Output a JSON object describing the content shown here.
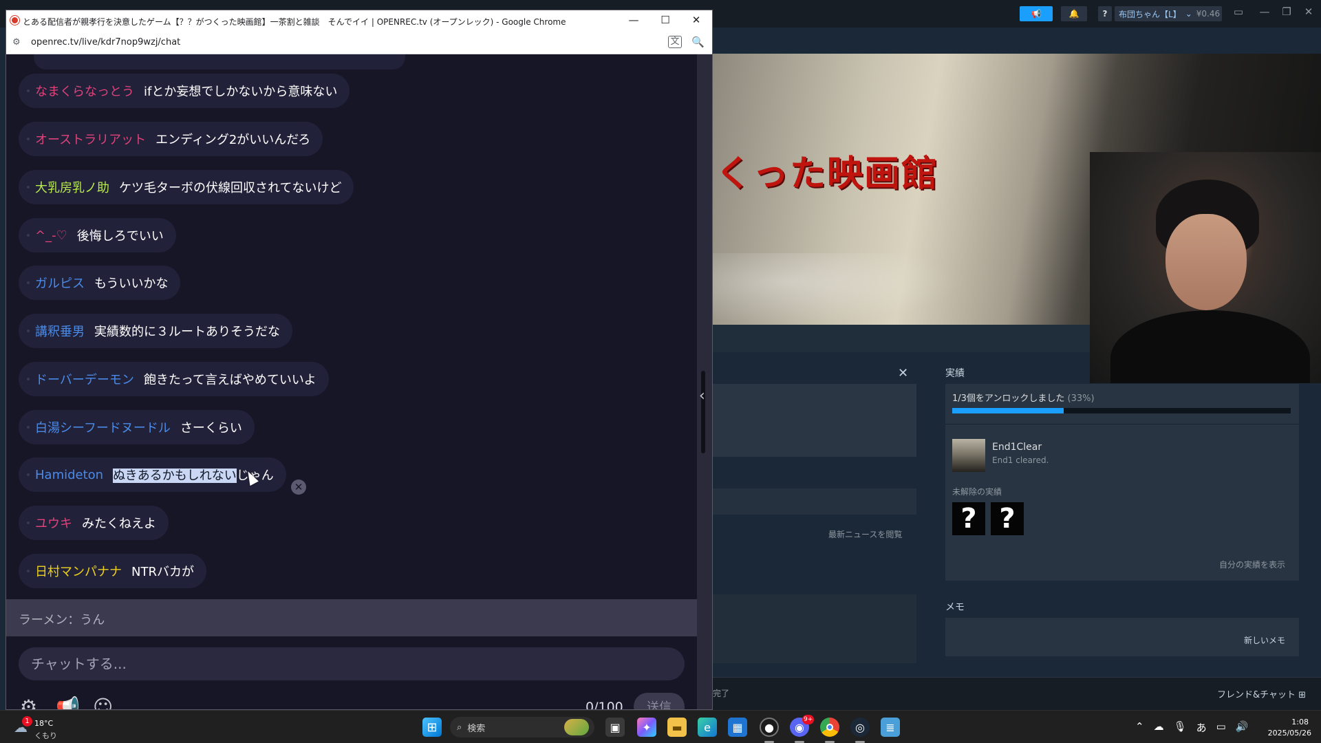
{
  "chrome": {
    "title": "とある配信者が親孝行を決意したゲーム【？？がつくった映画館】一茶割と雑談　そんでイイ | OPENREC.tv (オープンレック) - Google Chrome",
    "url": "openrec.tv/live/kdr7nop9wzj/chat",
    "translate_glyph": "文"
  },
  "chat": {
    "messages": [
      {
        "user": "なまくらなっとう",
        "text": "ifとか妄想でしかないから意味ない",
        "color": "#e0427a"
      },
      {
        "user": "オーストラリアット",
        "text": "エンディング2がいいんだろ",
        "color": "#e0427a"
      },
      {
        "user": "大乳房乳ノ助",
        "text": "ケツ毛ターボの伏線回収されてないけど",
        "color": "#b7ea4a"
      },
      {
        "user": "^_-♡",
        "text": "後悔しろでいい",
        "color": "#e0427a"
      },
      {
        "user": "ガルピス",
        "text": "もういいかな",
        "color": "#4a8be8"
      },
      {
        "user": "講釈垂男",
        "text": "実績数的に３ルートありそうだな",
        "color": "#4a8be8"
      },
      {
        "user": "ドーバーデーモン",
        "text": "飽きたって言えばやめていいよ",
        "color": "#4a8be8"
      },
      {
        "user": "白湯シーフードヌードル",
        "text": "さーくらい",
        "color": "#4a8be8"
      },
      {
        "user": "Hamideton",
        "text_highlighted": "ぬきあるかもしれない",
        "text_rest": "じゃん",
        "color": "#4a8be8"
      },
      {
        "user": "ユウキ",
        "text": "みたくねえよ",
        "color": "#e0427a"
      },
      {
        "user": "日村マンパナナ",
        "text": "NTRバカが",
        "color": "#ecd21e"
      }
    ],
    "pinned": "ラーメン：うん",
    "input_placeholder": "チャットする...",
    "char_count": "0/100",
    "send_label": "送信",
    "delete_glyph": "✕",
    "collapse_glyph": "‹"
  },
  "steam": {
    "user_name": "布団ちゃん【L】",
    "user_balance": "¥0.46",
    "help_label": "?",
    "hero_title": "くった映画館",
    "achievements_title": "実績",
    "achievements_progress": "1/3個をアンロックしました",
    "achievements_percent": "(33%)",
    "achievements_progress_fraction": 0.33,
    "achievement_name": "End1Clear",
    "achievement_desc": "End1 cleared.",
    "locked_label": "未解除の実績",
    "locked_glyph": "?",
    "show_my_achievements": "自分の実績を表示",
    "latest_news": "最新ニュースを閲覧",
    "memo_title": "メモ",
    "new_memo": "新しいメモ",
    "download_status": "完了",
    "friends_chat": "フレンド&チャット",
    "close_glyph": "✕"
  },
  "taskbar": {
    "weather_temp": "18°C",
    "weather_condition": "くもり",
    "weather_badge": "1",
    "search_placeholder": "検索",
    "discord_badge": "9+",
    "clock_time": "1:08",
    "clock_date": "2025/05/26",
    "ime_label": "あ"
  },
  "colors": {
    "chat_bg": "#171627",
    "bubble_bg": "#22213a",
    "steam_accent": "#1a9fff",
    "hero_title": "#c0140f"
  }
}
